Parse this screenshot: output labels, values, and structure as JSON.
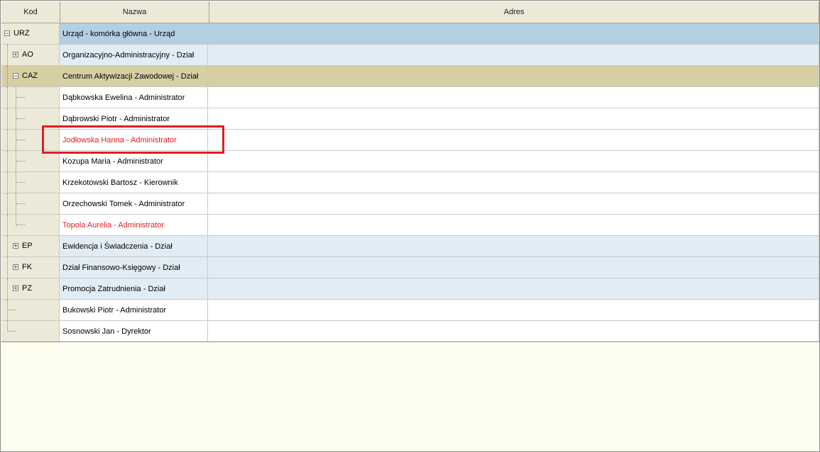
{
  "columns": {
    "kod": "Kod",
    "nazwa": "Nazwa",
    "adres": "Adres"
  },
  "rows": [
    {
      "code": "URZ",
      "name": "Urząd - komórka główna - Urząd",
      "toggle": "−"
    },
    {
      "code": "AO",
      "name": "Organizacyjno-Administracyjny - Dział",
      "toggle": "+"
    },
    {
      "code": "CAZ",
      "name": "Centrum Aktywizacji Zawodowej - Dział",
      "toggle": "−"
    },
    {
      "name": "Dąbkowska Ewelina - Administrator"
    },
    {
      "name": "Dąbrowski Piotr - Administrator"
    },
    {
      "name": "Jodłowska Hanna - Administrator"
    },
    {
      "name": "Kozupa Maria - Administrator"
    },
    {
      "name": "Krzekotowski Bartosz - Kierownik"
    },
    {
      "name": "Orzechowski Tomek - Administrator"
    },
    {
      "name": "Topola Aurelia - Administrator"
    },
    {
      "code": "EP",
      "name": "Ewidencja i Świadczenia - Dział",
      "toggle": "+"
    },
    {
      "code": "FK",
      "name": "Dział Finansowo-Księgowy - Dział",
      "toggle": "+"
    },
    {
      "code": "PZ",
      "name": "Promocja Zatrudnienia - Dział",
      "toggle": "+"
    },
    {
      "name": "Bukowski Piotr - Administrator"
    },
    {
      "name": "Sosnowski Jan - Dyrektor"
    }
  ],
  "colors": {
    "highlight": "#e41c24",
    "error_text": "#e02020",
    "root_row": "#b4cfe2",
    "dept_row": "#e1ecf4",
    "open_dept_row": "#d6cfa3"
  }
}
